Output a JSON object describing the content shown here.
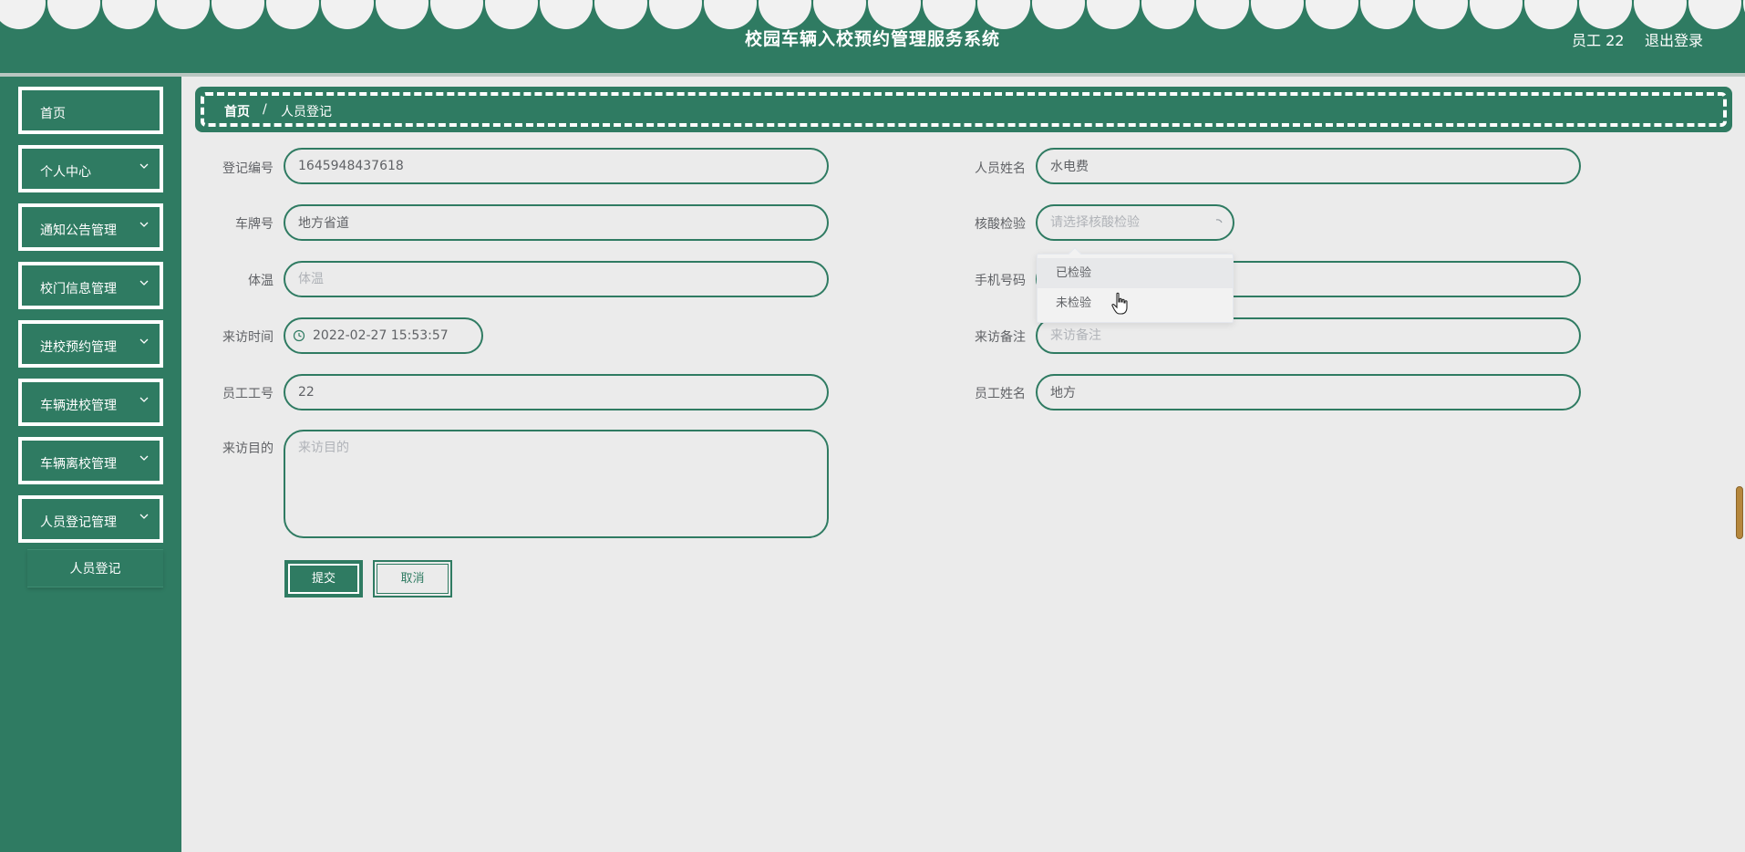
{
  "header": {
    "title": "校园车辆入校预约管理服务系统",
    "user": "员工 22",
    "logout": "退出登录"
  },
  "sidebar": {
    "items": [
      {
        "label": "首页",
        "has_children": false
      },
      {
        "label": "个人中心",
        "has_children": true
      },
      {
        "label": "通知公告管理",
        "has_children": true
      },
      {
        "label": "校门信息管理",
        "has_children": true
      },
      {
        "label": "进校预约管理",
        "has_children": true
      },
      {
        "label": "车辆进校管理",
        "has_children": true
      },
      {
        "label": "车辆离校管理",
        "has_children": true
      },
      {
        "label": "人员登记管理",
        "has_children": true
      }
    ],
    "submenu": {
      "label": "人员登记"
    }
  },
  "breadcrumb": {
    "home": "首页",
    "separator": "/",
    "current": "人员登记"
  },
  "form": {
    "reg_no": {
      "label": "登记编号",
      "value": "1645948437618"
    },
    "person_name": {
      "label": "人员姓名",
      "value": "水电费"
    },
    "plate": {
      "label": "车牌号",
      "value": "地方省道"
    },
    "nucleic": {
      "label": "核酸检验",
      "placeholder": "请选择核酸检验",
      "options": [
        "已检验",
        "未检验"
      ]
    },
    "temperature": {
      "label": "体温",
      "placeholder": "体温"
    },
    "phone": {
      "label": "手机号码",
      "value": ""
    },
    "visit_time": {
      "label": "来访时间",
      "value": "2022-02-27 15:53:57"
    },
    "visit_note": {
      "label": "来访备注",
      "placeholder": "来访备注"
    },
    "staff_no": {
      "label": "员工工号",
      "value": "22"
    },
    "staff_name": {
      "label": "员工姓名",
      "value": "地方"
    },
    "purpose": {
      "label": "来访目的",
      "placeholder": "来访目的"
    },
    "submit": "提交",
    "cancel": "取消"
  },
  "colors": {
    "primary": "#2f7b62",
    "background": "#ebebeb",
    "scrollbar": "#b5873c"
  }
}
